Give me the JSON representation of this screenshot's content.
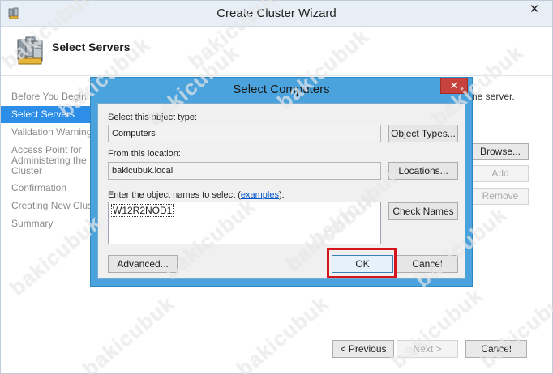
{
  "wizard": {
    "title": "Create Cluster Wizard",
    "header_title": "Select Servers",
    "nav": [
      {
        "label": "Before You Begin"
      },
      {
        "label": "Select Servers"
      },
      {
        "label": "Validation Warning"
      },
      {
        "label": "Access Point for Administering the Cluster"
      },
      {
        "label": "Confirmation"
      },
      {
        "label": "Creating New Cluster"
      },
      {
        "label": "Summary"
      }
    ],
    "body_fragment": "ne server.",
    "side_buttons": {
      "browse": "Browse...",
      "add": "Add",
      "remove": "Remove"
    },
    "footer": {
      "previous": "< Previous",
      "next": "Next >",
      "cancel": "Cancel"
    }
  },
  "dialog": {
    "title": "Select Computers",
    "object_type_label": "Select this object type:",
    "object_type_value": "Computers",
    "object_types_button": "Object Types...",
    "location_label": "From this location:",
    "location_value": "bakicubuk.local",
    "locations_button": "Locations...",
    "names_label": "Enter the object names to select (",
    "names_label_link": "examples",
    "names_label_end": "):",
    "names_value": "W12R2NOD1",
    "check_names_button": "Check Names",
    "advanced_button": "Advanced...",
    "ok_button": "OK",
    "cancel_button": "Cancel"
  },
  "watermark": "bakicubuk",
  "colors": {
    "accent": "#2d8ee8",
    "dialog_frame": "#4aa3dc",
    "highlight": "#d6141b",
    "close_button": "#c7423d"
  }
}
